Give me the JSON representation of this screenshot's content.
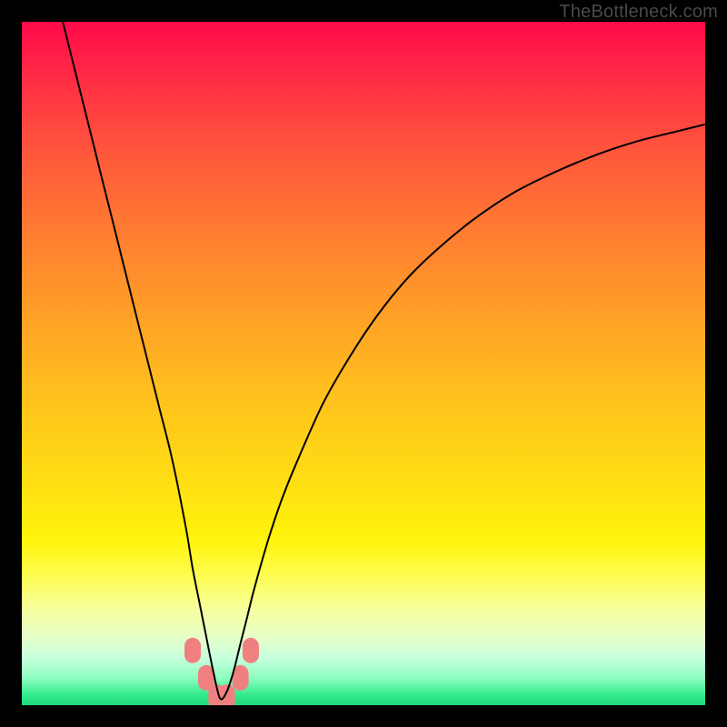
{
  "watermark": "TheBottleneck.com",
  "colors": {
    "frame": "#000000",
    "curve": "#000000",
    "marker": "#f08080",
    "gradient_top": "#ff0a4a",
    "gradient_bottom": "#1fd97e"
  },
  "chart_data": {
    "type": "line",
    "title": "",
    "xlabel": "",
    "ylabel": "",
    "xlim": [
      0,
      100
    ],
    "ylim": [
      0,
      100
    ],
    "grid": false,
    "legend": false,
    "notes": "Axes are unlabeled; values are estimated from the curve geometry. The curve forms a sharp V with minimum near x≈29, y≈1. Background gradient encodes value from high (red, top) to low (green, bottom). Salmon markers cluster near the trough.",
    "series": [
      {
        "name": "bottleneck-curve",
        "x": [
          6,
          8,
          10,
          12,
          14,
          16,
          18,
          20,
          22,
          24,
          25,
          26,
          27,
          28,
          29,
          30,
          31,
          32,
          33,
          34,
          36,
          38,
          40,
          44,
          48,
          52,
          56,
          60,
          66,
          72,
          78,
          84,
          90,
          96,
          100
        ],
        "y": [
          100,
          92,
          84,
          76,
          68,
          60,
          52,
          44,
          36,
          26,
          20,
          15,
          10,
          5,
          1,
          2,
          5,
          9,
          13,
          17,
          24,
          30,
          35,
          44,
          51,
          57,
          62,
          66,
          71,
          75,
          78,
          80.5,
          82.5,
          84,
          85
        ]
      }
    ],
    "markers": [
      {
        "x": 25,
        "y": 8
      },
      {
        "x": 27,
        "y": 4
      },
      {
        "x": 28.5,
        "y": 1.2
      },
      {
        "x": 30,
        "y": 1.2
      },
      {
        "x": 32,
        "y": 4
      },
      {
        "x": 33.5,
        "y": 8
      }
    ]
  }
}
